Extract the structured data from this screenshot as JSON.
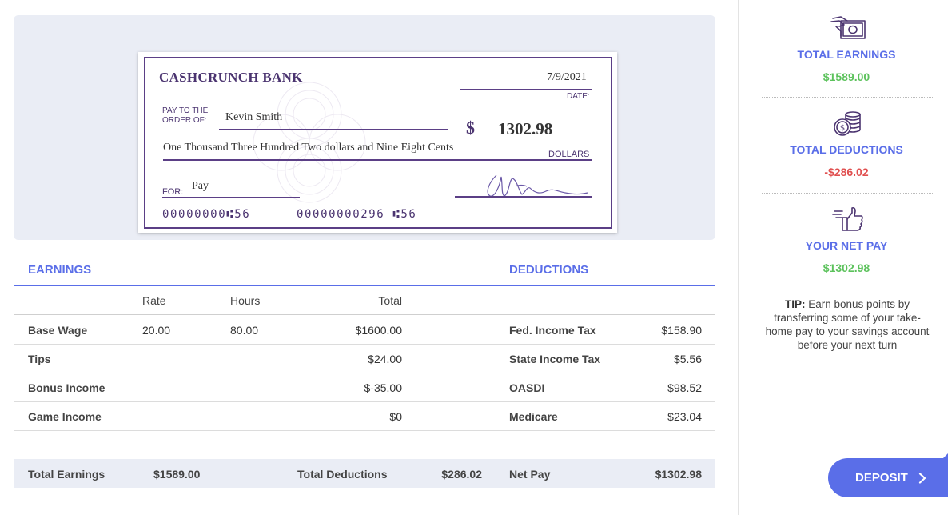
{
  "check": {
    "bank_name": "CASHCRUNCH BANK",
    "date": "7/9/2021",
    "date_label": "DATE:",
    "pay_to_label_1": "PAY TO THE",
    "pay_to_label_2": "ORDER OF:",
    "payee": "Kevin Smith",
    "currency_symbol": "$",
    "amount": "1302.98",
    "amount_words": "One Thousand Three Hundred Two dollars and Nine Eight Cents",
    "dollars_label": "DOLLARS",
    "for_label": "FOR:",
    "memo": "Pay",
    "routing": "00000000⑆56",
    "account": "00000000296 ⑆56"
  },
  "earnings": {
    "title": "EARNINGS",
    "headers": {
      "rate": "Rate",
      "hours": "Hours",
      "total": "Total"
    },
    "rows": [
      {
        "label": "Base Wage",
        "rate": "20.00",
        "hours": "80.00",
        "total": "$1600.00"
      },
      {
        "label": "Tips",
        "rate": "",
        "hours": "",
        "total": "$24.00"
      },
      {
        "label": "Bonus Income",
        "rate": "",
        "hours": "",
        "total": "$-35.00"
      },
      {
        "label": "Game Income",
        "rate": "",
        "hours": "",
        "total": "$0"
      }
    ]
  },
  "deductions": {
    "title": "DEDUCTIONS",
    "rows": [
      {
        "label": "Fed. Income Tax",
        "value": "$158.90"
      },
      {
        "label": "State Income Tax",
        "value": "$5.56"
      },
      {
        "label": "OASDI",
        "value": "$98.52"
      },
      {
        "label": "Medicare",
        "value": "$23.04"
      }
    ]
  },
  "totals": {
    "earnings_label": "Total Earnings",
    "earnings_value": "$1589.00",
    "deductions_label": "Total Deductions",
    "deductions_value": "$286.02",
    "net_label": "Net Pay",
    "net_value": "$1302.98"
  },
  "sidebar": {
    "total_earnings_title": "TOTAL EARNINGS",
    "total_earnings_value": "$1589.00",
    "total_deductions_title": "TOTAL DEDUCTIONS",
    "total_deductions_value": "-$286.02",
    "net_pay_title": "YOUR NET PAY",
    "net_pay_value": "$1302.98",
    "tip_label": "TIP:",
    "tip_text": " Earn bonus points by transferring some of your take-home pay to your savings account before your next turn",
    "deposit_label": "DEPOSIT",
    "icons": {
      "earnings": "cash-hand-icon",
      "deductions": "coins-icon",
      "net_pay": "thumbs-up-icon",
      "deposit": "chevron-right-icon"
    }
  },
  "colors": {
    "accent": "#5a6ee8",
    "check_purple": "#4b3470",
    "positive": "#5cc25c",
    "negative": "#e05050"
  }
}
